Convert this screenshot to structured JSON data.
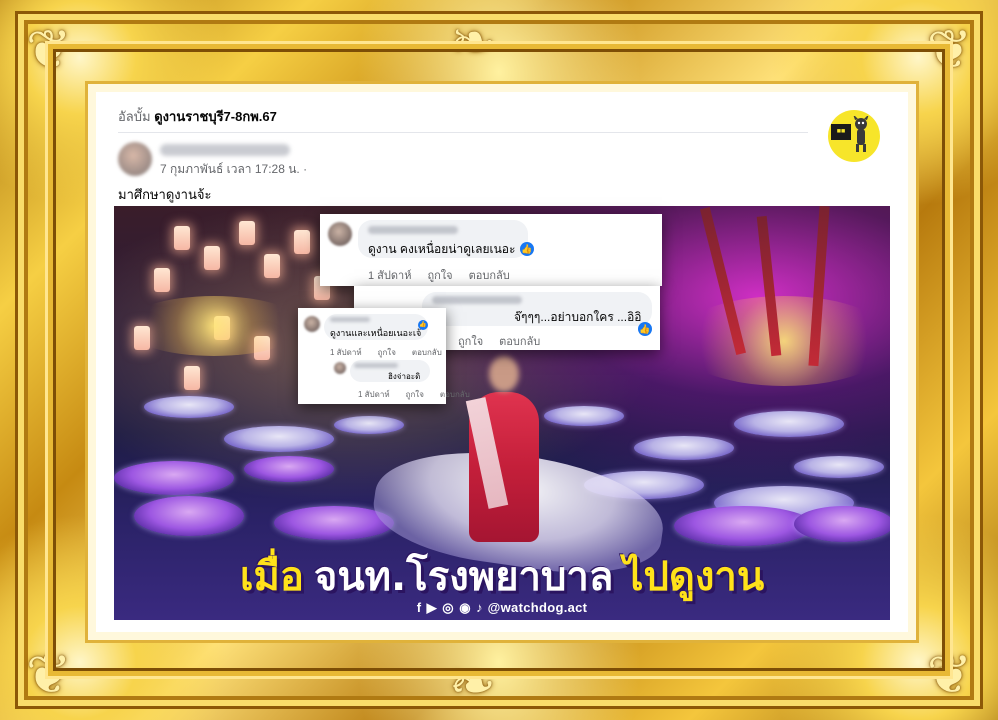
{
  "post": {
    "album_prefix": "อัลบั้ม",
    "album_name": "ดูงานราชบุรี7-8กพ.67",
    "timestamp": "7 กุมภาพันธ์ เวลา 17:28 น. ·",
    "text": "มาศึกษาดูงานจ้ะ"
  },
  "comments": [
    {
      "text": "ดูงาน คงเหนื่อยน่าดูเลยเนอะ",
      "time": "1 สัปดาห์",
      "like": "ถูกใจ",
      "reply": "ตอบกลับ"
    },
    {
      "text": "จ๊ๆๆๆ...อย่าบอกใคร ...อิอิ",
      "like": "ถูกใจ",
      "reply": "ตอบกลับ"
    },
    {
      "text": "ดูงานและเหนื่อยเนอะเจ้",
      "time": "1 สัปดาห์",
      "like": "ถูกใจ",
      "reply": "ตอบกลับ"
    },
    {
      "text": "ฮิงจ่าอะดิ",
      "time": "1 สัปดาห์",
      "like": "ถูกใจ",
      "reply": "ตอบกลับ"
    }
  ],
  "headline": {
    "part1": "เมื่อ",
    "part2": "จนท.โรงพยาบาล",
    "part3": "ไปดูงาน"
  },
  "social": {
    "icons": "f ▶ ◎ ◉ ♪",
    "handle": "@watchdog.act"
  },
  "icons": {
    "like": "thumbs-up-icon",
    "logo": "watchdog-logo"
  },
  "colors": {
    "frame_gold": "#f6cf44",
    "headline_yellow": "#ffe21a",
    "facebook_blue": "#1877f2",
    "photo_purple": "#3a2a80"
  }
}
